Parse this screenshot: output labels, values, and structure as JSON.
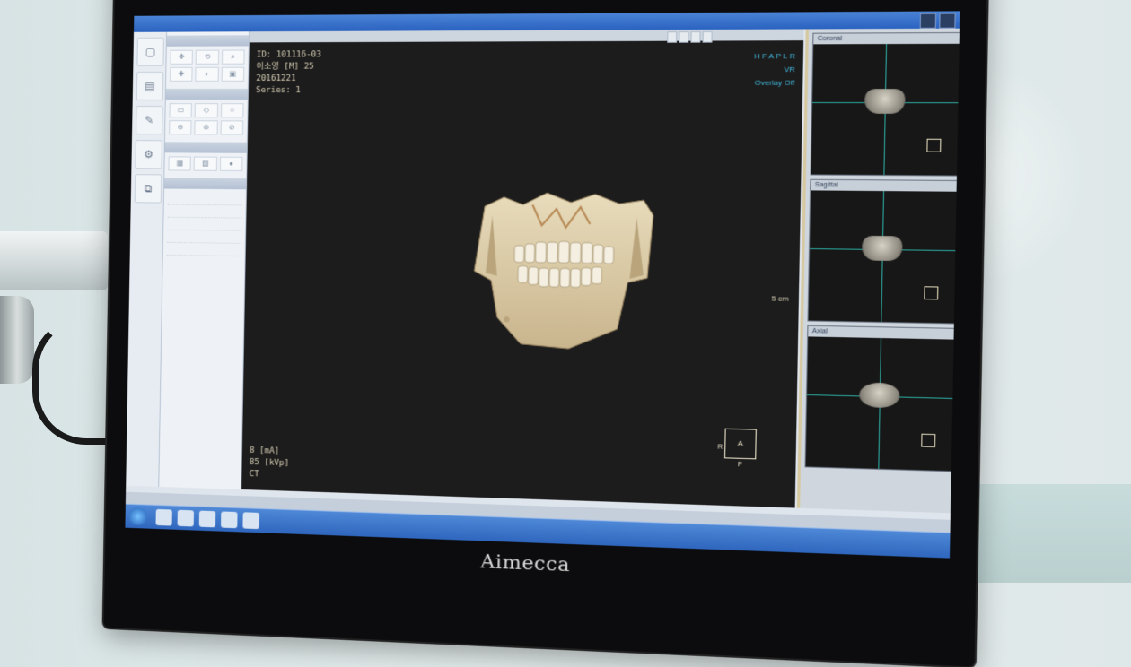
{
  "brand": "Aimecca",
  "viewer": {
    "patient_id": "ID: 101116-03",
    "patient_line2": "이소영 [M] 25",
    "date": "20161221",
    "series": "Series: 1",
    "ma": "8 [mA]",
    "kvp": "85 [kVp]",
    "modality": "CT",
    "orientation_letters": "H F A P L R",
    "mode": "VR",
    "overlay": "Overlay Off",
    "scale": "5 cm",
    "cube_center": "A",
    "cube_left": "R",
    "cube_bottom": "F"
  },
  "views": {
    "coronal": "Coronal",
    "sagittal": "Sagittal",
    "axial": "Axial"
  }
}
